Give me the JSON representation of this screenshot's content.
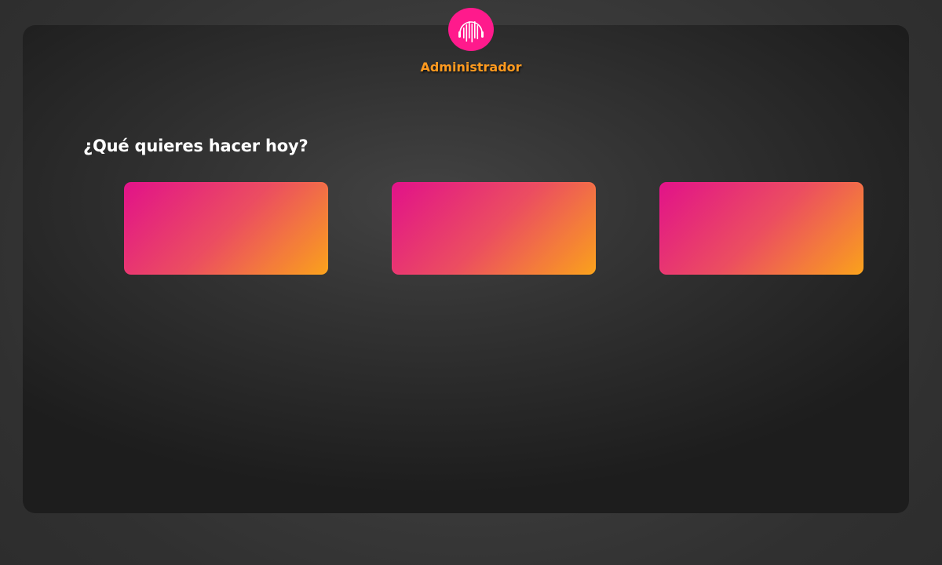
{
  "header": {
    "logo_icon": "soundwave-headphones-icon",
    "role": "Administrador"
  },
  "main": {
    "heading": "¿Qué quieres hacer hoy?",
    "option_cards": [
      {
        "label": ""
      },
      {
        "label": ""
      },
      {
        "label": ""
      }
    ]
  },
  "colors": {
    "accent_pink": "#ff1a8c",
    "accent_orange": "#ff9a1f",
    "card_border_start": "#e6128c",
    "card_border_end": "#ffa51c",
    "panel_background": "#2a2a2a",
    "page_background": "#3a3a3a"
  }
}
